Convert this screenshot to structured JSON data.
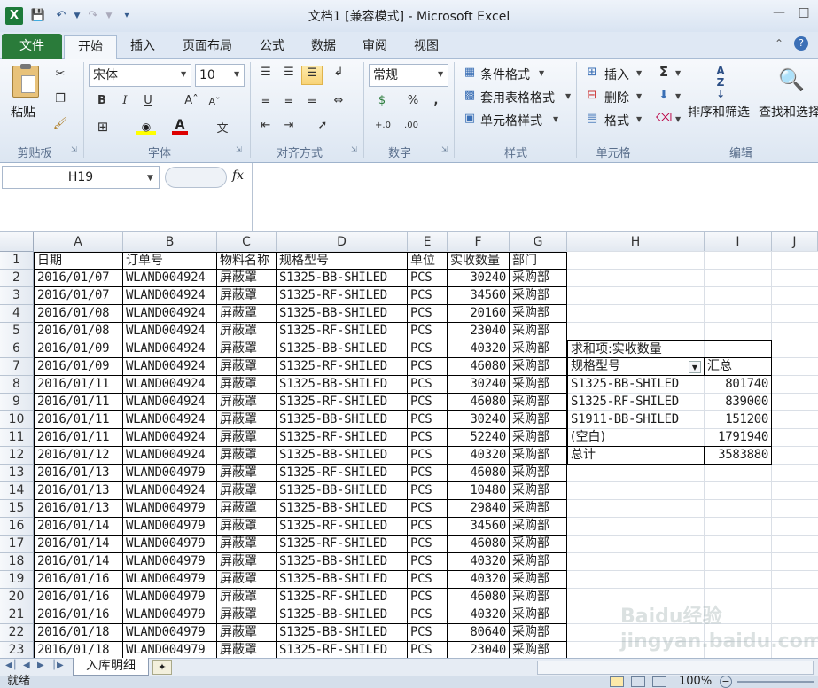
{
  "window": {
    "title": "文档1  [兼容模式] - Microsoft Excel"
  },
  "tabs": [
    "文件",
    "开始",
    "插入",
    "页面布局",
    "公式",
    "数据",
    "审阅",
    "视图"
  ],
  "active_tab": "开始",
  "ribbon": {
    "clipboard": {
      "label": "剪贴板",
      "paste": "粘贴"
    },
    "font": {
      "label": "字体",
      "font_name": "宋体",
      "font_size": "10"
    },
    "alignment": {
      "label": "对齐方式"
    },
    "number": {
      "label": "数字",
      "format": "常规"
    },
    "styles": {
      "label": "样式",
      "conditional": "条件格式",
      "table_format": "套用表格格式",
      "cell_styles": "单元格样式"
    },
    "cells": {
      "label": "单元格",
      "insert": "插入",
      "delete": "删除",
      "format": "格式"
    },
    "editing": {
      "label": "编辑",
      "sort_filter": "排序和筛选",
      "find_select": "查找和选择"
    }
  },
  "formula_bar": {
    "name_box": "H19",
    "fx": "fx",
    "formula": ""
  },
  "columns": [
    "A",
    "B",
    "C",
    "D",
    "E",
    "F",
    "G",
    "H",
    "I",
    "J"
  ],
  "sheet": {
    "header_row": [
      "日期",
      "订单号",
      "物料名称",
      "规格型号",
      "单位",
      "实收数量",
      "部门"
    ],
    "rows": [
      [
        "2016/01/07",
        "WLAND004924",
        "屏蔽罩",
        "S1325-BB-SHILED",
        "PCS",
        "30240",
        "采购部"
      ],
      [
        "2016/01/07",
        "WLAND004924",
        "屏蔽罩",
        "S1325-RF-SHILED",
        "PCS",
        "34560",
        "采购部"
      ],
      [
        "2016/01/08",
        "WLAND004924",
        "屏蔽罩",
        "S1325-BB-SHILED",
        "PCS",
        "20160",
        "采购部"
      ],
      [
        "2016/01/08",
        "WLAND004924",
        "屏蔽罩",
        "S1325-RF-SHILED",
        "PCS",
        "23040",
        "采购部"
      ],
      [
        "2016/01/09",
        "WLAND004924",
        "屏蔽罩",
        "S1325-BB-SHILED",
        "PCS",
        "40320",
        "采购部"
      ],
      [
        "2016/01/09",
        "WLAND004924",
        "屏蔽罩",
        "S1325-RF-SHILED",
        "PCS",
        "46080",
        "采购部"
      ],
      [
        "2016/01/11",
        "WLAND004924",
        "屏蔽罩",
        "S1325-BB-SHILED",
        "PCS",
        "30240",
        "采购部"
      ],
      [
        "2016/01/11",
        "WLAND004924",
        "屏蔽罩",
        "S1325-RF-SHILED",
        "PCS",
        "46080",
        "采购部"
      ],
      [
        "2016/01/11",
        "WLAND004924",
        "屏蔽罩",
        "S1325-BB-SHILED",
        "PCS",
        "30240",
        "采购部"
      ],
      [
        "2016/01/11",
        "WLAND004924",
        "屏蔽罩",
        "S1325-RF-SHILED",
        "PCS",
        "52240",
        "采购部"
      ],
      [
        "2016/01/12",
        "WLAND004924",
        "屏蔽罩",
        "S1325-BB-SHILED",
        "PCS",
        "40320",
        "采购部"
      ],
      [
        "2016/01/13",
        "WLAND004979",
        "屏蔽罩",
        "S1325-RF-SHILED",
        "PCS",
        "46080",
        "采购部"
      ],
      [
        "2016/01/13",
        "WLAND004924",
        "屏蔽罩",
        "S1325-BB-SHILED",
        "PCS",
        "10480",
        "采购部"
      ],
      [
        "2016/01/13",
        "WLAND004979",
        "屏蔽罩",
        "S1325-BB-SHILED",
        "PCS",
        "29840",
        "采购部"
      ],
      [
        "2016/01/14",
        "WLAND004979",
        "屏蔽罩",
        "S1325-RF-SHILED",
        "PCS",
        "34560",
        "采购部"
      ],
      [
        "2016/01/14",
        "WLAND004979",
        "屏蔽罩",
        "S1325-RF-SHILED",
        "PCS",
        "46080",
        "采购部"
      ],
      [
        "2016/01/14",
        "WLAND004979",
        "屏蔽罩",
        "S1325-BB-SHILED",
        "PCS",
        "40320",
        "采购部"
      ],
      [
        "2016/01/16",
        "WLAND004979",
        "屏蔽罩",
        "S1325-BB-SHILED",
        "PCS",
        "40320",
        "采购部"
      ],
      [
        "2016/01/16",
        "WLAND004979",
        "屏蔽罩",
        "S1325-RF-SHILED",
        "PCS",
        "46080",
        "采购部"
      ],
      [
        "2016/01/16",
        "WLAND004979",
        "屏蔽罩",
        "S1325-BB-SHILED",
        "PCS",
        "40320",
        "采购部"
      ],
      [
        "2016/01/18",
        "WLAND004979",
        "屏蔽罩",
        "S1325-BB-SHILED",
        "PCS",
        "80640",
        "采购部"
      ],
      [
        "2016/01/18",
        "WLAND004979",
        "屏蔽罩",
        "S1325-RF-SHILED",
        "PCS",
        "23040",
        "采购部"
      ]
    ]
  },
  "pivot": {
    "title": "求和项:实收数量",
    "row_label": "规格型号",
    "value_label": "汇总",
    "rows": [
      [
        "S1325-BB-SHILED",
        "801740"
      ],
      [
        "S1325-RF-SHILED",
        "839000"
      ],
      [
        "S1911-BB-SHILED",
        "151200"
      ],
      [
        "(空白)",
        "1791940"
      ]
    ],
    "total_label": "总计",
    "total_value": "3583880"
  },
  "sheet_tab": "入库明细",
  "status": {
    "ready": "就绪",
    "zoom": "100%"
  },
  "watermark": "Baidu经验 jingyan.baidu.com",
  "colors": {
    "file_tab": "#2a7b3a",
    "grid": "#d4d4d4",
    "border": "#000000"
  }
}
